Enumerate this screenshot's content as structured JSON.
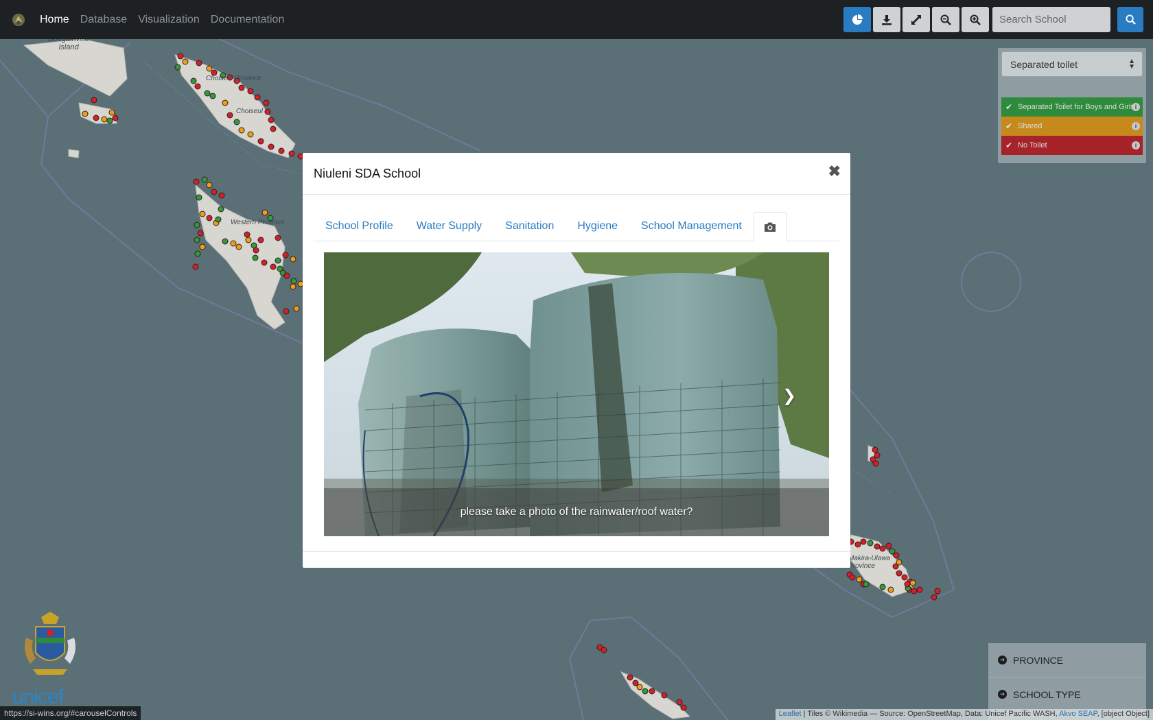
{
  "navbar": {
    "links": [
      "Home",
      "Database",
      "Visualization",
      "Documentation"
    ],
    "search_placeholder": "Search School"
  },
  "map": {
    "labels": {
      "island": "Bougainville Island",
      "choiseul_province": "Choiseul Province",
      "choiseul": "Choiseul",
      "western_province": "Western Province",
      "makira": "Makira-Ulawa Province"
    },
    "marker_colors": {
      "green": "#2e9b3e",
      "orange": "#e8a21a",
      "red": "#d0222b"
    }
  },
  "legend": {
    "selected": "Separated toilet",
    "items": [
      {
        "label": "Separated Toilet for Boys and Girls",
        "color": "#2e8b3c"
      },
      {
        "label": "Shared",
        "color": "#c58a1b"
      },
      {
        "label": "No Toilet",
        "color": "#a6232a"
      }
    ]
  },
  "filters": [
    "PROVINCE",
    "SCHOOL TYPE"
  ],
  "modal": {
    "title": "Niuleni SDA School",
    "close": "✖",
    "tabs": [
      "School Profile",
      "Water Supply",
      "Sanitation",
      "Hygiene",
      "School Management"
    ],
    "active_tab_icon": "camera-icon",
    "photo_caption": "please take a photo of the rainwater/roof water?"
  },
  "branding": {
    "unicef": "unicef"
  },
  "status_url": "https://si-wins.org/#carouselControls",
  "attribution": {
    "leaflet": "Leaflet",
    "text": " | Tiles © Wikimedia — Source: OpenStreetMap, Data: Unicef Pacific WASH, ",
    "akvo": "Akvo SEAP",
    "tail": ", [object Object]"
  }
}
